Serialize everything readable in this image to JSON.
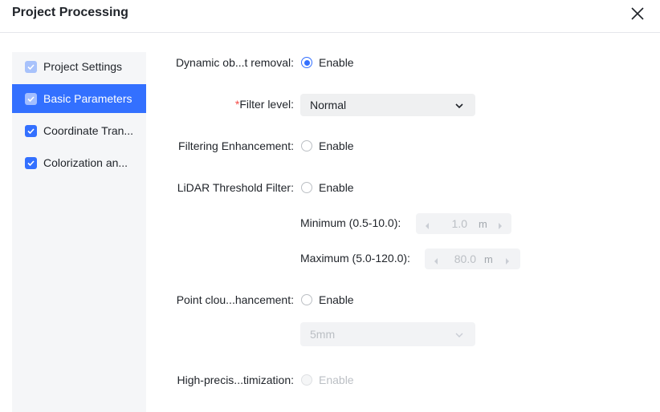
{
  "header": {
    "title": "Project Processing"
  },
  "sidebar": {
    "items": [
      {
        "label": "Project Settings",
        "checked": true
      },
      {
        "label": "Basic Parameters",
        "checked": true,
        "active": true
      },
      {
        "label": "Coordinate Tran...",
        "checked": true
      },
      {
        "label": "Colorization an...",
        "checked": true
      }
    ]
  },
  "form": {
    "dynamic_object_removal": {
      "label": "Dynamic ob...t removal:",
      "option": "Enable",
      "selected": true
    },
    "filter_level": {
      "required_mark": "*",
      "label": "Filter level:",
      "value": "Normal"
    },
    "filtering_enhancement": {
      "label": "Filtering Enhancement:",
      "option": "Enable",
      "selected": false
    },
    "lidar_threshold_filter": {
      "label": "LiDAR Threshold Filter:",
      "option": "Enable",
      "selected": false,
      "minimum": {
        "label": "Minimum (0.5-10.0):",
        "value": "1.0",
        "unit": "m"
      },
      "maximum": {
        "label": "Maximum (5.0-120.0):",
        "value": "80.0",
        "unit": "m"
      }
    },
    "point_cloud_enhancement": {
      "label": "Point clou...hancement:",
      "option": "Enable",
      "selected": false,
      "select_value": "5mm"
    },
    "high_precision_optimization": {
      "label": "High-precis...timization:",
      "option": "Enable",
      "selected": false,
      "disabled": true
    }
  },
  "colors": {
    "accent": "#3370ff",
    "sidebar_bg": "#f5f6f8",
    "required": "#f54a45"
  }
}
